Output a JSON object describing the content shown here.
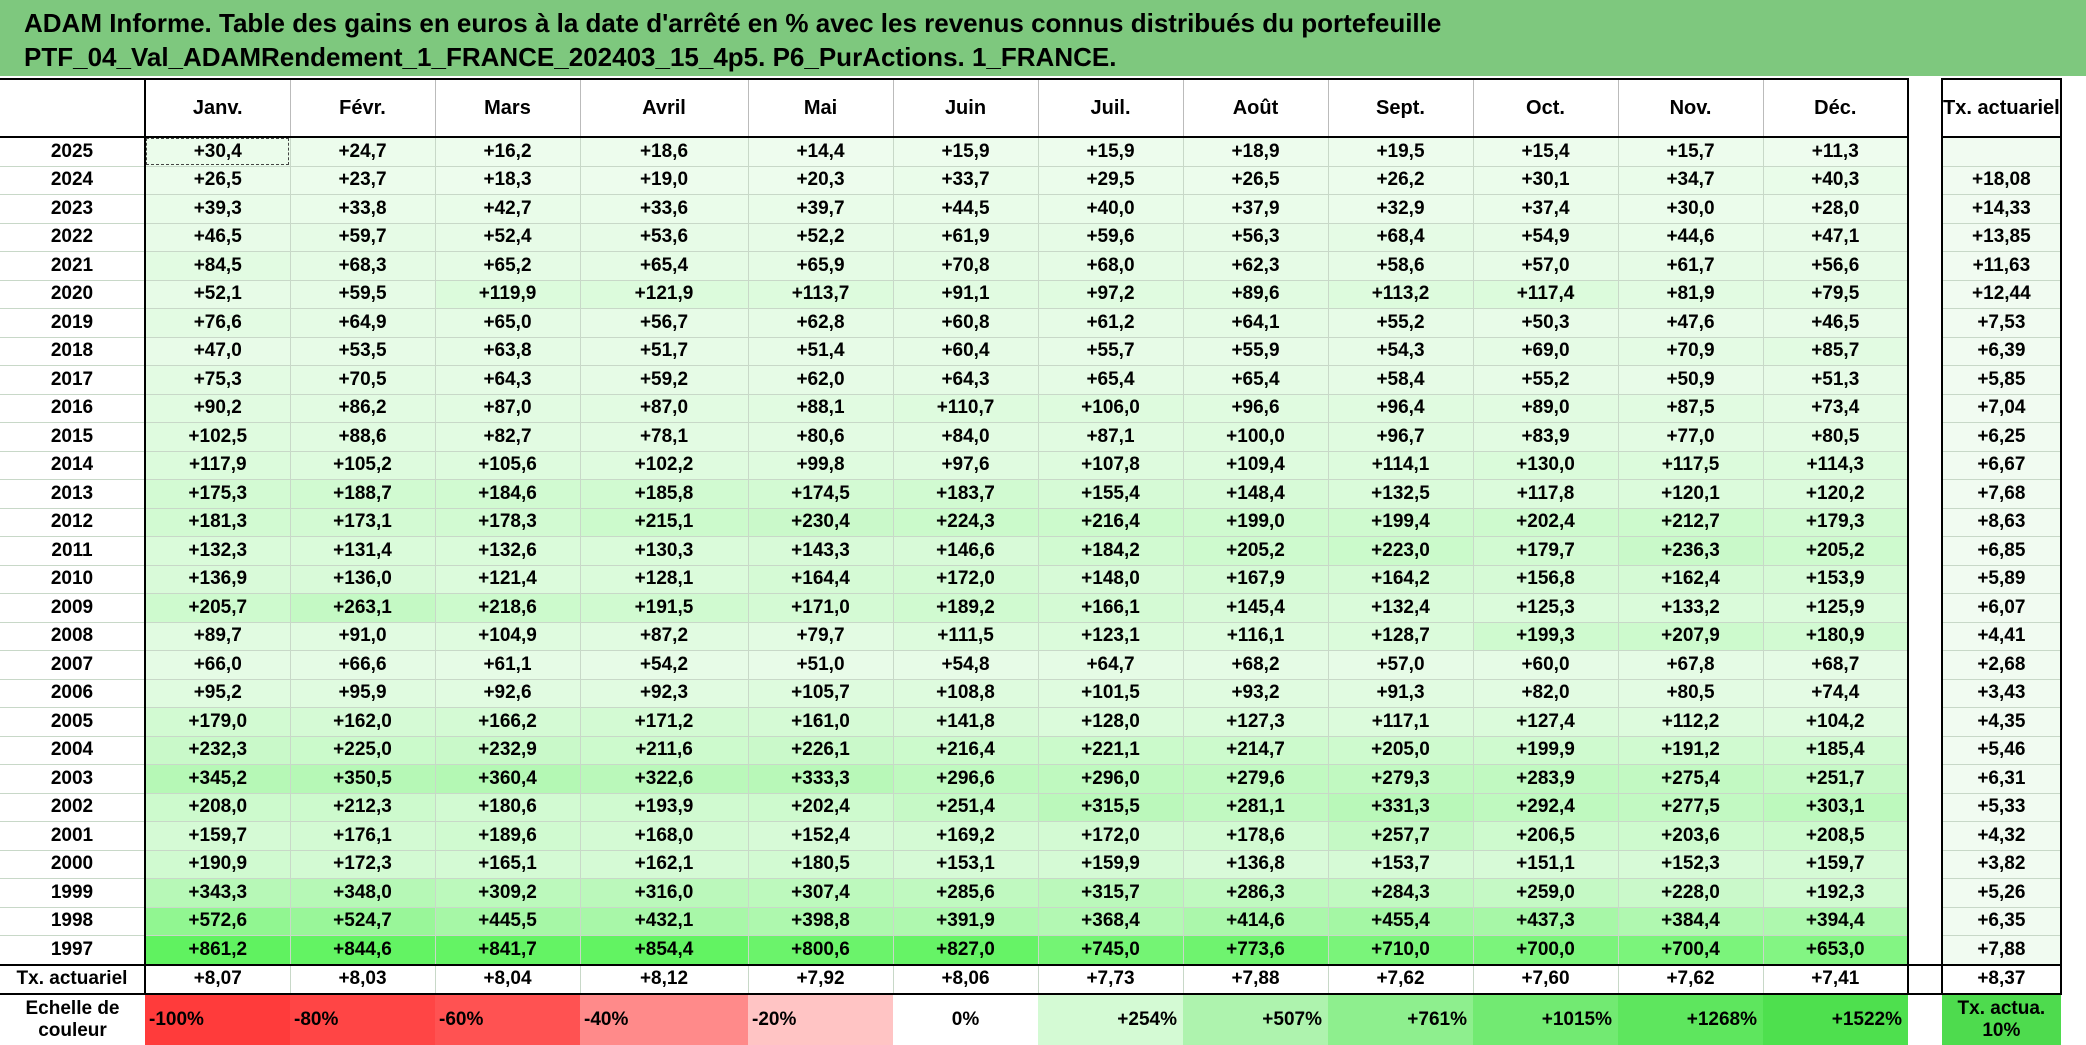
{
  "title": {
    "line1": "ADAM Informe. Table des gains en euros à la date d'arrêté en % avec les revenus connus distribués du portefeuille",
    "line2": "PTF_04_Val_ADAMRendement_1_FRANCE_202403_15_4p5. P6_PurActions. 1_FRANCE."
  },
  "months": [
    "Janv.",
    "Févr.",
    "Mars",
    "Avril",
    "Mai",
    "Juin",
    "Juil.",
    "Août",
    "Sept.",
    "Oct.",
    "Nov.",
    "Déc."
  ],
  "rate_header": "Tx. actuariel",
  "rows": [
    {
      "year": "2025",
      "values": [
        "+30,4",
        "+24,7",
        "+16,2",
        "+18,6",
        "+14,4",
        "+15,9",
        "+15,9",
        "+18,9",
        "+19,5",
        "+15,4",
        "+15,7",
        "+11,3"
      ],
      "rate": ""
    },
    {
      "year": "2024",
      "values": [
        "+26,5",
        "+23,7",
        "+18,3",
        "+19,0",
        "+20,3",
        "+33,7",
        "+29,5",
        "+26,5",
        "+26,2",
        "+30,1",
        "+34,7",
        "+40,3"
      ],
      "rate": "+18,08"
    },
    {
      "year": "2023",
      "values": [
        "+39,3",
        "+33,8",
        "+42,7",
        "+33,6",
        "+39,7",
        "+44,5",
        "+40,0",
        "+37,9",
        "+32,9",
        "+37,4",
        "+30,0",
        "+28,0"
      ],
      "rate": "+14,33"
    },
    {
      "year": "2022",
      "values": [
        "+46,5",
        "+59,7",
        "+52,4",
        "+53,6",
        "+52,2",
        "+61,9",
        "+59,6",
        "+56,3",
        "+68,4",
        "+54,9",
        "+44,6",
        "+47,1"
      ],
      "rate": "+13,85"
    },
    {
      "year": "2021",
      "values": [
        "+84,5",
        "+68,3",
        "+65,2",
        "+65,4",
        "+65,9",
        "+70,8",
        "+68,0",
        "+62,3",
        "+58,6",
        "+57,0",
        "+61,7",
        "+56,6"
      ],
      "rate": "+11,63"
    },
    {
      "year": "2020",
      "values": [
        "+52,1",
        "+59,5",
        "+119,9",
        "+121,9",
        "+113,7",
        "+91,1",
        "+97,2",
        "+89,6",
        "+113,2",
        "+117,4",
        "+81,9",
        "+79,5"
      ],
      "rate": "+12,44"
    },
    {
      "year": "2019",
      "values": [
        "+76,6",
        "+64,9",
        "+65,0",
        "+56,7",
        "+62,8",
        "+60,8",
        "+61,2",
        "+64,1",
        "+55,2",
        "+50,3",
        "+47,6",
        "+46,5"
      ],
      "rate": "+7,53"
    },
    {
      "year": "2018",
      "values": [
        "+47,0",
        "+53,5",
        "+63,8",
        "+51,7",
        "+51,4",
        "+60,4",
        "+55,7",
        "+55,9",
        "+54,3",
        "+69,0",
        "+70,9",
        "+85,7"
      ],
      "rate": "+6,39"
    },
    {
      "year": "2017",
      "values": [
        "+75,3",
        "+70,5",
        "+64,3",
        "+59,2",
        "+62,0",
        "+64,3",
        "+65,4",
        "+65,4",
        "+58,4",
        "+55,2",
        "+50,9",
        "+51,3"
      ],
      "rate": "+5,85"
    },
    {
      "year": "2016",
      "values": [
        "+90,2",
        "+86,2",
        "+87,0",
        "+87,0",
        "+88,1",
        "+110,7",
        "+106,0",
        "+96,6",
        "+96,4",
        "+89,0",
        "+87,5",
        "+73,4"
      ],
      "rate": "+7,04"
    },
    {
      "year": "2015",
      "values": [
        "+102,5",
        "+88,6",
        "+82,7",
        "+78,1",
        "+80,6",
        "+84,0",
        "+87,1",
        "+100,0",
        "+96,7",
        "+83,9",
        "+77,0",
        "+80,5"
      ],
      "rate": "+6,25"
    },
    {
      "year": "2014",
      "values": [
        "+117,9",
        "+105,2",
        "+105,6",
        "+102,2",
        "+99,8",
        "+97,6",
        "+107,8",
        "+109,4",
        "+114,1",
        "+130,0",
        "+117,5",
        "+114,3"
      ],
      "rate": "+6,67"
    },
    {
      "year": "2013",
      "values": [
        "+175,3",
        "+188,7",
        "+184,6",
        "+185,8",
        "+174,5",
        "+183,7",
        "+155,4",
        "+148,4",
        "+132,5",
        "+117,8",
        "+120,1",
        "+120,2"
      ],
      "rate": "+7,68"
    },
    {
      "year": "2012",
      "values": [
        "+181,3",
        "+173,1",
        "+178,3",
        "+215,1",
        "+230,4",
        "+224,3",
        "+216,4",
        "+199,0",
        "+199,4",
        "+202,4",
        "+212,7",
        "+179,3"
      ],
      "rate": "+8,63"
    },
    {
      "year": "2011",
      "values": [
        "+132,3",
        "+131,4",
        "+132,6",
        "+130,3",
        "+143,3",
        "+146,6",
        "+184,2",
        "+205,2",
        "+223,0",
        "+179,7",
        "+236,3",
        "+205,2"
      ],
      "rate": "+6,85"
    },
    {
      "year": "2010",
      "values": [
        "+136,9",
        "+136,0",
        "+121,4",
        "+128,1",
        "+164,4",
        "+172,0",
        "+148,0",
        "+167,9",
        "+164,2",
        "+156,8",
        "+162,4",
        "+153,9"
      ],
      "rate": "+5,89"
    },
    {
      "year": "2009",
      "values": [
        "+205,7",
        "+263,1",
        "+218,6",
        "+191,5",
        "+171,0",
        "+189,2",
        "+166,1",
        "+145,4",
        "+132,4",
        "+125,3",
        "+133,2",
        "+125,9"
      ],
      "rate": "+6,07"
    },
    {
      "year": "2008",
      "values": [
        "+89,7",
        "+91,0",
        "+104,9",
        "+87,2",
        "+79,7",
        "+111,5",
        "+123,1",
        "+116,1",
        "+128,7",
        "+199,3",
        "+207,9",
        "+180,9"
      ],
      "rate": "+4,41"
    },
    {
      "year": "2007",
      "values": [
        "+66,0",
        "+66,6",
        "+61,1",
        "+54,2",
        "+51,0",
        "+54,8",
        "+64,7",
        "+68,2",
        "+57,0",
        "+60,0",
        "+67,8",
        "+68,7"
      ],
      "rate": "+2,68"
    },
    {
      "year": "2006",
      "values": [
        "+95,2",
        "+95,9",
        "+92,6",
        "+92,3",
        "+105,7",
        "+108,8",
        "+101,5",
        "+93,2",
        "+91,3",
        "+82,0",
        "+80,5",
        "+74,4"
      ],
      "rate": "+3,43"
    },
    {
      "year": "2005",
      "values": [
        "+179,0",
        "+162,0",
        "+166,2",
        "+171,2",
        "+161,0",
        "+141,8",
        "+128,0",
        "+127,3",
        "+117,1",
        "+127,4",
        "+112,2",
        "+104,2"
      ],
      "rate": "+4,35"
    },
    {
      "year": "2004",
      "values": [
        "+232,3",
        "+225,0",
        "+232,9",
        "+211,6",
        "+226,1",
        "+216,4",
        "+221,1",
        "+214,7",
        "+205,0",
        "+199,9",
        "+191,2",
        "+185,4"
      ],
      "rate": "+5,46"
    },
    {
      "year": "2003",
      "values": [
        "+345,2",
        "+350,5",
        "+360,4",
        "+322,6",
        "+333,3",
        "+296,6",
        "+296,0",
        "+279,6",
        "+279,3",
        "+283,9",
        "+275,4",
        "+251,7"
      ],
      "rate": "+6,31"
    },
    {
      "year": "2002",
      "values": [
        "+208,0",
        "+212,3",
        "+180,6",
        "+193,9",
        "+202,4",
        "+251,4",
        "+315,5",
        "+281,1",
        "+331,3",
        "+292,4",
        "+277,5",
        "+303,1"
      ],
      "rate": "+5,33"
    },
    {
      "year": "2001",
      "values": [
        "+159,7",
        "+176,1",
        "+189,6",
        "+168,0",
        "+152,4",
        "+169,2",
        "+172,0",
        "+178,6",
        "+257,7",
        "+206,5",
        "+203,6",
        "+208,5"
      ],
      "rate": "+4,32"
    },
    {
      "year": "2000",
      "values": [
        "+190,9",
        "+172,3",
        "+165,1",
        "+162,1",
        "+180,5",
        "+153,1",
        "+159,9",
        "+136,8",
        "+153,7",
        "+151,1",
        "+152,3",
        "+159,7"
      ],
      "rate": "+3,82"
    },
    {
      "year": "1999",
      "values": [
        "+343,3",
        "+348,0",
        "+309,2",
        "+316,0",
        "+307,4",
        "+285,6",
        "+315,7",
        "+286,3",
        "+284,3",
        "+259,0",
        "+228,0",
        "+192,3"
      ],
      "rate": "+5,26"
    },
    {
      "year": "1998",
      "values": [
        "+572,6",
        "+524,7",
        "+445,5",
        "+432,1",
        "+398,8",
        "+391,9",
        "+368,4",
        "+414,6",
        "+455,4",
        "+437,3",
        "+384,4",
        "+394,4"
      ],
      "rate": "+6,35"
    },
    {
      "year": "1997",
      "values": [
        "+861,2",
        "+844,6",
        "+841,7",
        "+854,4",
        "+800,6",
        "+827,0",
        "+745,0",
        "+773,6",
        "+710,0",
        "+700,0",
        "+700,4",
        "+653,0"
      ],
      "rate": "+7,88"
    }
  ],
  "average_row": {
    "label": "Tx. actuariel",
    "values": [
      "+8,07",
      "+8,03",
      "+8,04",
      "+8,12",
      "+7,92",
      "+8,06",
      "+7,73",
      "+7,88",
      "+7,62",
      "+7,60",
      "+7,62",
      "+7,41"
    ],
    "rate": "+8,37"
  },
  "color_scale": {
    "label": "Echelle de couleur",
    "steps": [
      {
        "text": "-100%",
        "color": "#ff3b3b"
      },
      {
        "text": "-80%",
        "color": "#ff4545"
      },
      {
        "text": "-60%",
        "color": "#ff5252"
      },
      {
        "text": "-40%",
        "color": "#ff8a8a"
      },
      {
        "text": "-20%",
        "color": "#ffc4c4"
      },
      {
        "text": "0%",
        "color": "#ffffff"
      },
      {
        "text": "+254%",
        "color": "#d4fad4"
      },
      {
        "text": "+507%",
        "color": "#aef3ae"
      },
      {
        "text": "+761%",
        "color": "#8eef8e"
      },
      {
        "text": "+1015%",
        "color": "#72ea72"
      },
      {
        "text": "+1268%",
        "color": "#5ee65e"
      },
      {
        "text": "+1522%",
        "color": "#4ee04e"
      }
    ],
    "rate_label": "Tx. actua. 10%",
    "rate_color": "#4edb4e"
  }
}
